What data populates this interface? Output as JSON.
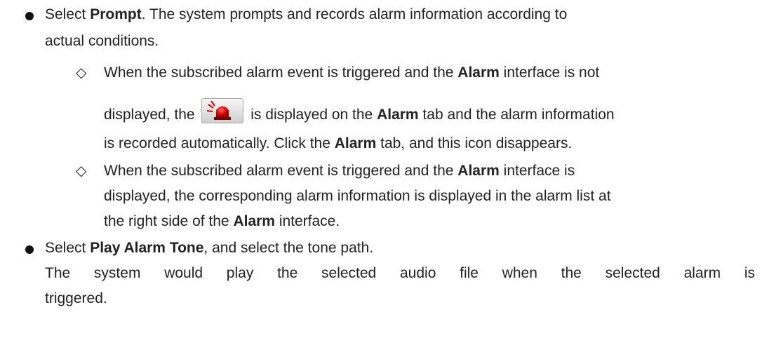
{
  "items": {
    "b1": {
      "pre": "Select ",
      "bold": "Prompt",
      "post": ". The system prompts and records alarm information according to",
      "l2": "actual conditions."
    },
    "s1": {
      "l1_pre": "When the subscribed alarm event is triggered and the ",
      "l1_bold": "Alarm",
      "l1_post": " interface is not",
      "l2_pre": "displayed, the ",
      "l2_mid": " is displayed on the ",
      "l2_bold": "Alarm",
      "l2_post": " tab and the alarm information",
      "l3_pre": "is recorded automatically. Click the ",
      "l3_bold": "Alarm",
      "l3_post": " tab, and this icon disappears."
    },
    "s2": {
      "l1_pre": "When the subscribed alarm event is triggered and the ",
      "l1_bold": "Alarm",
      "l1_post": " interface is",
      "l2": "displayed, the corresponding alarm information is displayed in the alarm list at",
      "l3_pre": "the right side of the ",
      "l3_bold": "Alarm",
      "l3_post": " interface."
    },
    "b2": {
      "pre": "Select ",
      "bold": "Play Alarm Tone",
      "post": ", and select the tone path.",
      "l2": "The system would play the selected audio file when the selected alarm is",
      "l3": "triggered."
    }
  },
  "marker": "◇",
  "icon": "alarm-siren-icon",
  "colors": {
    "text": "#222222",
    "icon_red": "#d40000",
    "icon_bg": "#e8e8e8"
  }
}
